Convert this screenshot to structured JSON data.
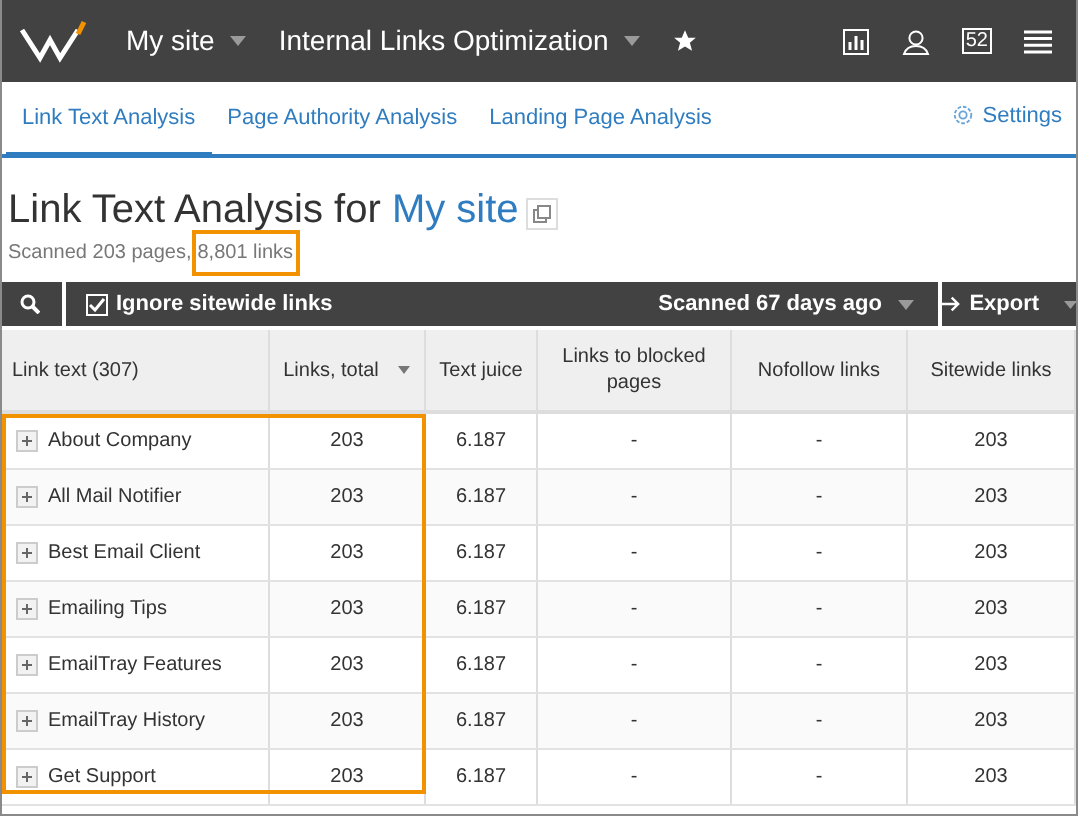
{
  "topbar": {
    "site": "My site",
    "module": "Internal Links Optimization",
    "badge": "52"
  },
  "tabs": [
    {
      "label": "Link Text Analysis",
      "selected": true
    },
    {
      "label": "Page Authority Analysis",
      "selected": false
    },
    {
      "label": "Landing Page Analysis",
      "selected": false
    }
  ],
  "settings": "Settings",
  "heading": {
    "text": "Link Text Analysis for",
    "site": "My site"
  },
  "summary": {
    "pages": "Scanned 203 pages,",
    "links": "8,801 links",
    "links_highlighted": true
  },
  "toolbar": {
    "ignore_sitewide": {
      "label": "Ignore sitewide links",
      "checked": true
    },
    "scanned": "Scanned 67 days ago",
    "export": "Export"
  },
  "table": {
    "columns": [
      {
        "label": "Link text (307)",
        "sorted": false,
        "highlighted": true
      },
      {
        "label": "Links, total",
        "sorted": true,
        "highlighted": true
      },
      {
        "label": "Text juice",
        "sorted": false,
        "highlighted": false
      },
      {
        "label": "Links to blocked pages",
        "sorted": false,
        "highlighted": false
      },
      {
        "label": "Nofollow links",
        "sorted": false,
        "highlighted": false
      },
      {
        "label": "Sitewide links",
        "sorted": false,
        "highlighted": false
      }
    ],
    "rows": [
      [
        "About Company",
        "203",
        "6.187",
        "-",
        "-",
        "203"
      ],
      [
        "All Mail Notifier",
        "203",
        "6.187",
        "-",
        "-",
        "203"
      ],
      [
        "Best Email Client",
        "203",
        "6.187",
        "-",
        "-",
        "203"
      ],
      [
        "Emailing Tips",
        "203",
        "6.187",
        "-",
        "-",
        "203"
      ],
      [
        "EmailTray Features",
        "203",
        "6.187",
        "-",
        "-",
        "203"
      ],
      [
        "EmailTray History",
        "203",
        "6.187",
        "-",
        "-",
        "203"
      ],
      [
        "Get Support",
        "203",
        "6.187",
        "-",
        "-",
        "203"
      ]
    ]
  }
}
